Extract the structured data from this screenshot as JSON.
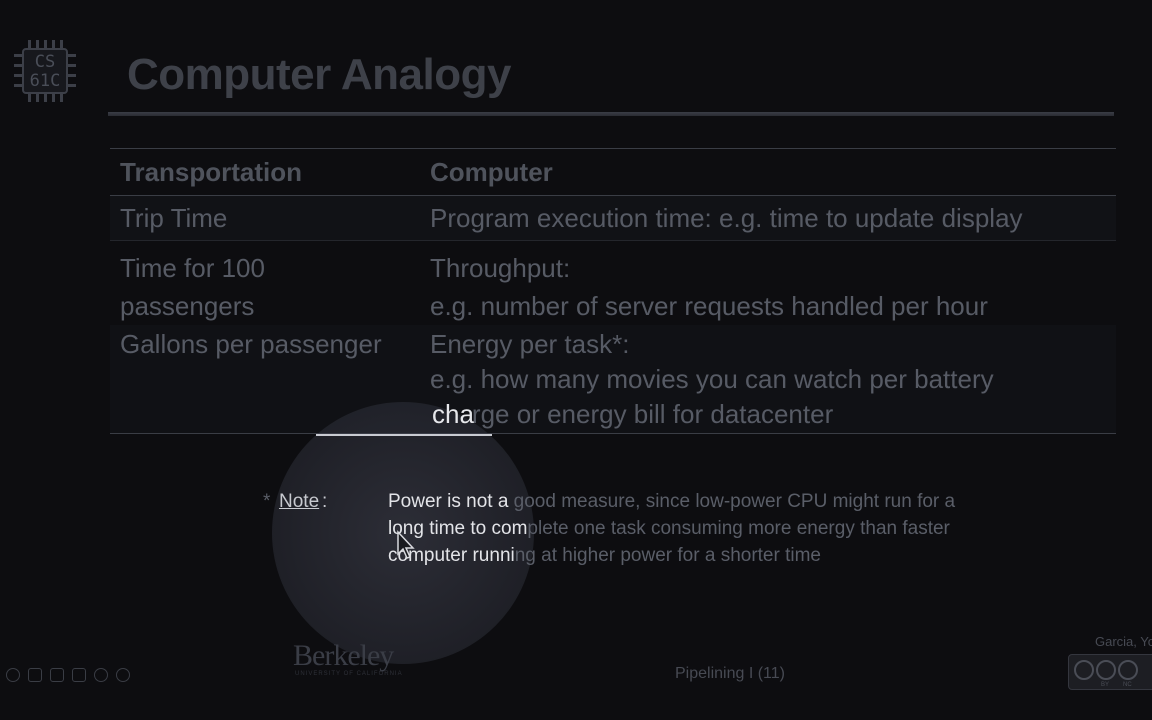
{
  "logo": {
    "line1": "CS",
    "line2": "61C"
  },
  "slide": {
    "title": "Computer Analogy"
  },
  "table": {
    "headers": [
      "Transportation",
      "Computer"
    ],
    "rows": [
      {
        "left": "Trip Time",
        "right": "Program execution time: e.g. time to update display"
      },
      {
        "left_line1": "Time for 100",
        "left_line2": "passengers",
        "right_line1": "Throughput:",
        "right_line2": "e.g. number of server requests handled per hour"
      },
      {
        "left": "Gallons per passenger",
        "right_line1": "Energy per task*:",
        "right_line2": "e.g. how many movies you can watch per battery",
        "right_line3a": "cha",
        "right_line3b": "rge or energy bill for datacenter"
      }
    ]
  },
  "note": {
    "star": "*",
    "label": "Note",
    "colon": ":",
    "line1a": "Power is not a ",
    "line1b": "good measure, since low-power CPU might run for a",
    "line2a": "long time to com",
    "line2b": "plete one task consuming more energy than faster",
    "line3a": "computer runni",
    "line3b": "ng at higher power for a shorter time"
  },
  "footer": {
    "berkeley": "Berkeley",
    "berkeley_sub": "UNIVERSITY OF CALIFORNIA",
    "center": "Pipelining I (11)",
    "author": "Garcia, Yo",
    "cc_by": "BY",
    "cc_nc": "NC"
  },
  "icons": [
    "chip-logo-icon",
    "cursor-icon",
    "creative-commons-icon",
    "slideshow-nav-icons"
  ]
}
